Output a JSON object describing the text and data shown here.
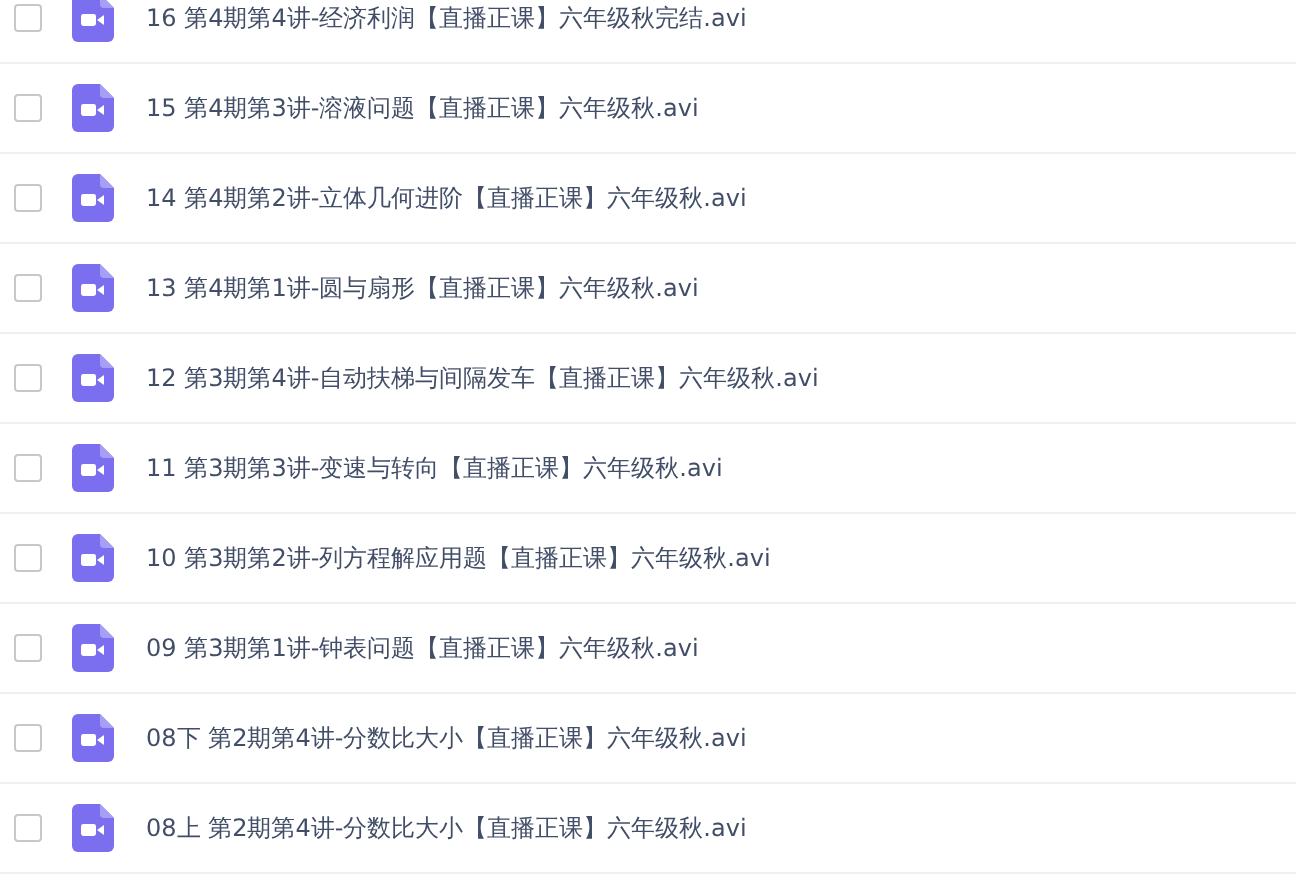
{
  "files": [
    {
      "name": "16 第4期第4讲-经济利润【直播正课】六年级秋完结.avi",
      "checked": false
    },
    {
      "name": "15 第4期第3讲-溶液问题【直播正课】六年级秋.avi",
      "checked": false
    },
    {
      "name": "14 第4期第2讲-立体几何进阶【直播正课】六年级秋.avi",
      "checked": false
    },
    {
      "name": "13 第4期第1讲-圆与扇形【直播正课】六年级秋.avi",
      "checked": false
    },
    {
      "name": "12 第3期第4讲-自动扶梯与间隔发车【直播正课】六年级秋.avi",
      "checked": false
    },
    {
      "name": "11 第3期第3讲-变速与转向【直播正课】六年级秋.avi",
      "checked": false
    },
    {
      "name": "10 第3期第2讲-列方程解应用题【直播正课】六年级秋.avi",
      "checked": false
    },
    {
      "name": "09 第3期第1讲-钟表问题【直播正课】六年级秋.avi",
      "checked": false
    },
    {
      "name": "08下 第2期第4讲-分数比大小【直播正课】六年级秋.avi",
      "checked": false
    },
    {
      "name": "08上 第2期第4讲-分数比大小【直播正课】六年级秋.avi",
      "checked": false
    }
  ]
}
